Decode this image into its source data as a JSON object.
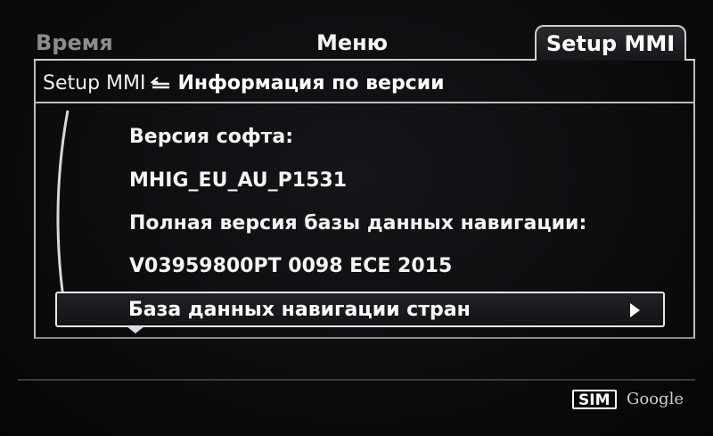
{
  "tabs": {
    "time": "Время",
    "menu": "Меню",
    "setup": "Setup MMI"
  },
  "breadcrumb": {
    "parent": "Setup MMI",
    "back_icon": "return-arrow-icon",
    "title": "Информация по версии"
  },
  "info": {
    "software_label": "Версия софта:",
    "software_value": "MHIG_EU_AU_P1531",
    "navdb_label": "Полная версия базы данных навигации:",
    "navdb_value": "V03959800PT 0098 ECE 2015"
  },
  "selection": {
    "label": "База данных навигации стран",
    "arrow_icon": "chevron-right-icon"
  },
  "status": {
    "sim": "SIM",
    "google": "Google"
  },
  "colors": {
    "background": "#0b0b0d",
    "text": "#f2f2f2",
    "inactive_tab": "#8c8c90",
    "frame": "#bdbdbd"
  }
}
